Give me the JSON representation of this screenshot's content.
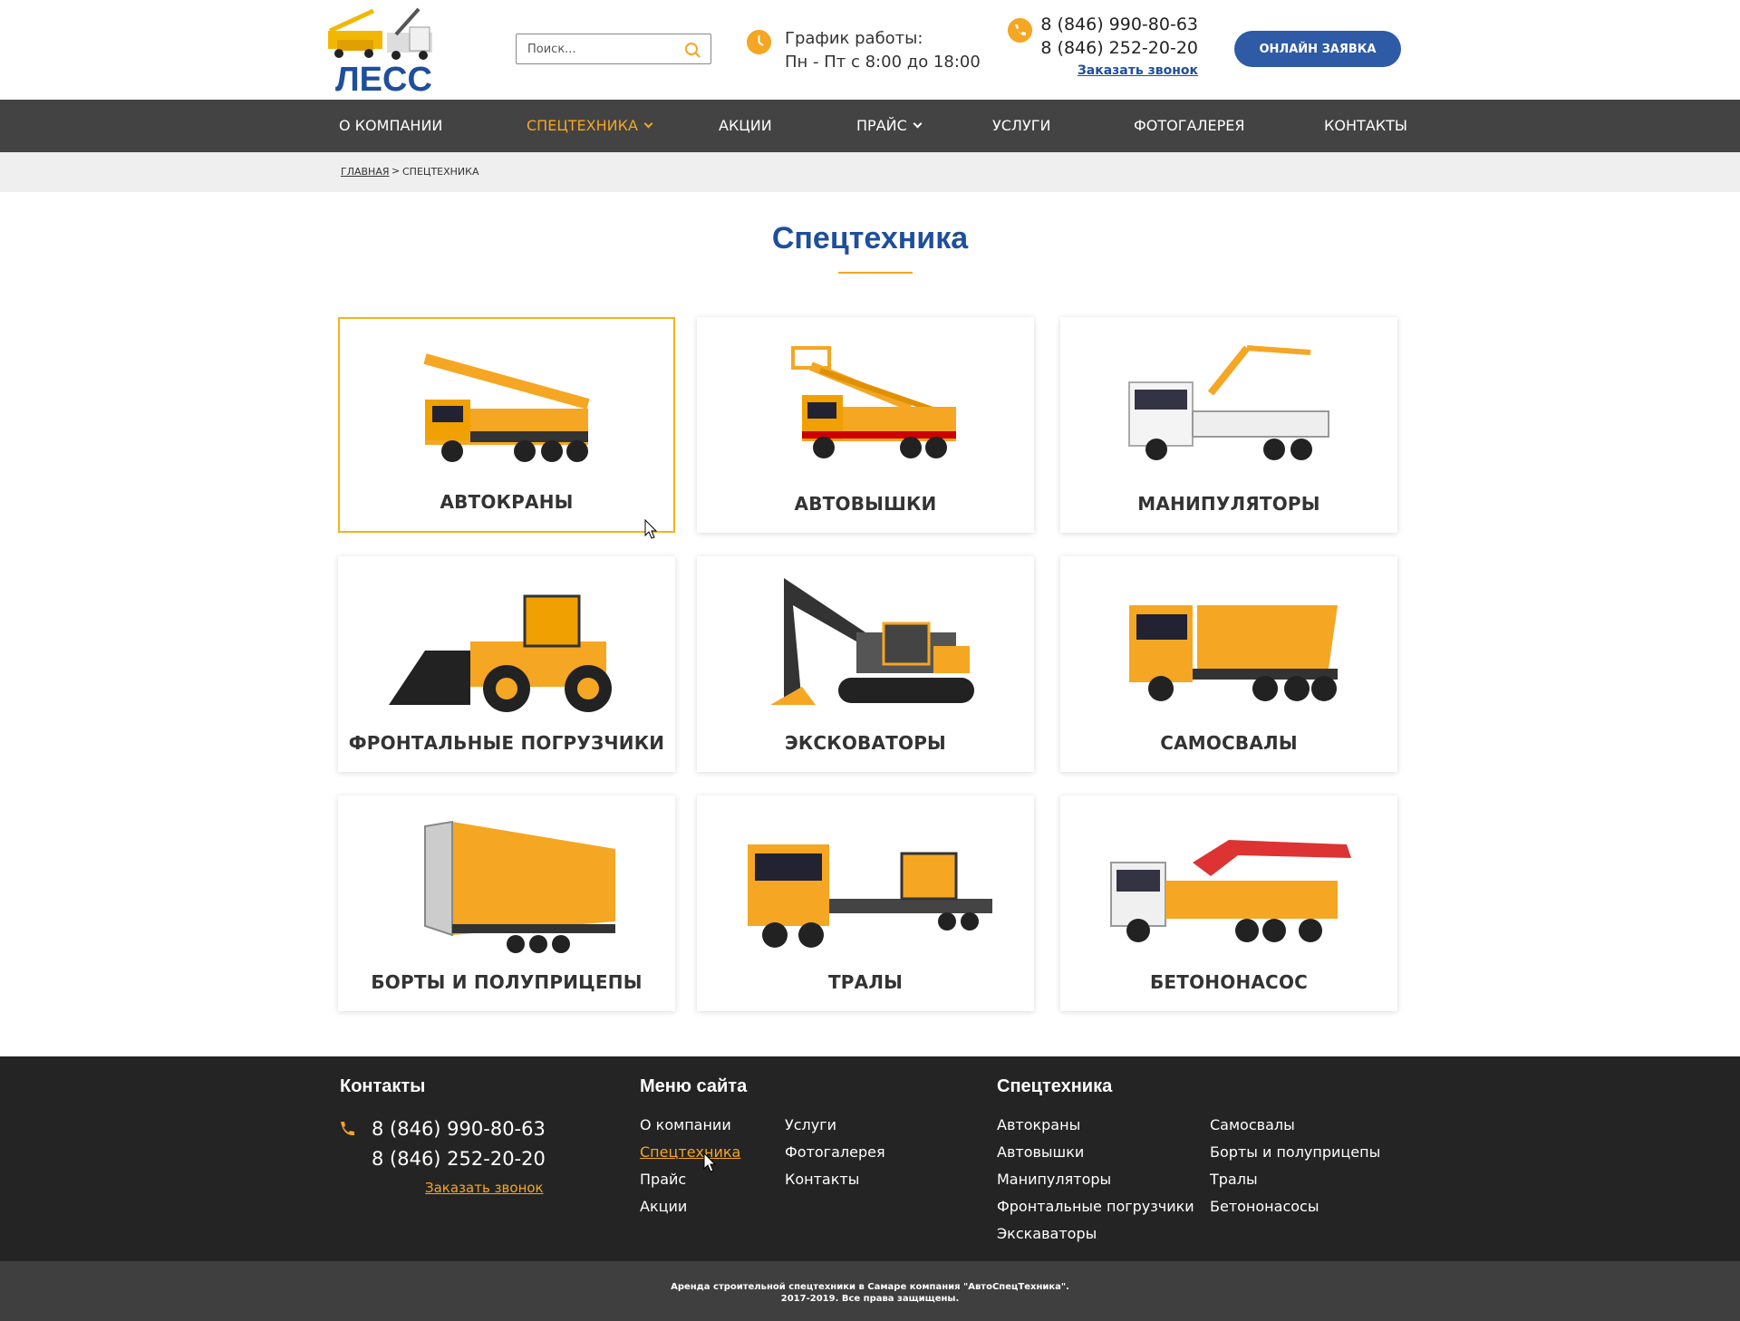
{
  "header": {
    "logo_text": "ЛЕСС",
    "search_placeholder": "Поиск...",
    "hours_title": "График работы:",
    "hours_value": "Пн - Пт с 8:00 до 18:00",
    "phone1": "8 (846) 990-80-63",
    "phone2": "8 (846) 252-20-20",
    "callback": "Заказать звонок",
    "cta": "ОНЛАЙН ЗАЯВКА",
    "icons": [
      "search-icon",
      "clock-icon",
      "phone-icon"
    ]
  },
  "nav": [
    {
      "label": "О КОМПАНИИ"
    },
    {
      "label": "СПЕЦТЕХНИКА",
      "active": true,
      "dropdown": true
    },
    {
      "label": "АКЦИИ"
    },
    {
      "label": "ПРАЙС",
      "dropdown": true
    },
    {
      "label": "УСЛУГИ"
    },
    {
      "label": "ФОТОГАЛЕРЕЯ"
    },
    {
      "label": "КОНТАКТЫ"
    }
  ],
  "breadcrumb": {
    "home": "ГЛАВНАЯ",
    "separator": ">",
    "current": "СПЕЦТЕХНИКА"
  },
  "title": "Спецтехника",
  "cards": [
    {
      "label": "АВТОКРАНЫ"
    },
    {
      "label": "АВТОВЫШКИ"
    },
    {
      "label": "МАНИПУЛЯТОРЫ"
    },
    {
      "label": "ФРОНТАЛЬНЫЕ ПОГРУЗЧИКИ"
    },
    {
      "label": "ЭКСКОВАТОРЫ"
    },
    {
      "label": "САМОСВАЛЫ"
    },
    {
      "label": "БОРТЫ И ПОЛУПРИЦЕПЫ"
    },
    {
      "label": "ТРАЛЫ"
    },
    {
      "label": "БЕТОНОНАСОС"
    }
  ],
  "footer": {
    "contacts_title": "Контакты",
    "phone1": "8 (846) 990-80-63",
    "phone2": "8 (846) 252-20-20",
    "callback": "Заказать звонок",
    "menu_title": "Меню сайта",
    "menu": [
      "О компании",
      "Спецтехника",
      "Прайс",
      "Акции",
      "Услуги",
      "Фотогалерея",
      "Контакты"
    ],
    "equipment_title": "Спецтехника",
    "equipment": [
      "Автокраны",
      "Автовышки",
      "Манипуляторы",
      "Фронтальные погрузчики",
      "Экскаваторы",
      "Самосвалы",
      "Борты и полуприцепы",
      "Тралы",
      "Бетононасосы"
    ],
    "copyright_line1": "Аренда строительной спецтехники в Самаре компания \"АвтоСпецТехника\".",
    "copyright_line2": "2017-2019. Все права защищены."
  },
  "colors": {
    "accent": "#f5a623",
    "brand_blue": "#2e5aa6",
    "title_blue": "#1f4e9c",
    "nav_bg": "#434343",
    "footer_bg": "#242424"
  }
}
